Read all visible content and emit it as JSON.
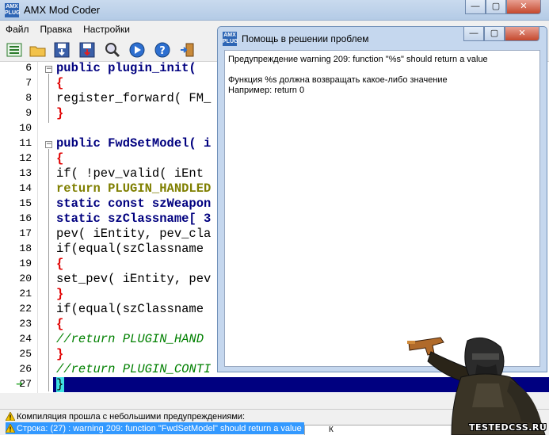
{
  "window": {
    "title": "AMX Mod Coder",
    "icon_text": "AMX\nPLUGIN"
  },
  "caption_buttons": {
    "minimize": "—",
    "maximize": "▢",
    "close": "✕"
  },
  "menu": [
    {
      "label": "Файл"
    },
    {
      "label": "Правка"
    },
    {
      "label": "Настройки"
    }
  ],
  "toolbar": [
    {
      "name": "list-icon"
    },
    {
      "name": "open-folder-icon"
    },
    {
      "name": "save-icon"
    },
    {
      "name": "save-as-icon"
    },
    {
      "name": "find-icon"
    },
    {
      "name": "compile-play-icon"
    },
    {
      "name": "help-icon"
    },
    {
      "name": "exit-icon"
    }
  ],
  "editor": {
    "lines": [
      {
        "num": "6",
        "text": "public plugin_init("
      },
      {
        "num": "7",
        "text": "{"
      },
      {
        "num": "8",
        "text": "register_forward( FM_"
      },
      {
        "num": "9",
        "text": "}"
      },
      {
        "num": "10",
        "text": ""
      },
      {
        "num": "11",
        "text": "public FwdSetModel( i"
      },
      {
        "num": "12",
        "text": "{"
      },
      {
        "num": "13",
        "text": "if( !pev_valid( iEnt"
      },
      {
        "num": "14",
        "text": "return PLUGIN_HANDLED"
      },
      {
        "num": "15",
        "text": "static const szWeapon"
      },
      {
        "num": "16",
        "text": "static szClassname[ 3"
      },
      {
        "num": "17",
        "text": "pev( iEntity, pev_cla"
      },
      {
        "num": "18",
        "text": "if(equal(szClassname"
      },
      {
        "num": "19",
        "text": "{"
      },
      {
        "num": "20",
        "text": "set_pev( iEntity, pev"
      },
      {
        "num": "21",
        "text": "}"
      },
      {
        "num": "22",
        "text": "if(equal(szClassname"
      },
      {
        "num": "23",
        "text": "{"
      },
      {
        "num": "24",
        "text": "//return PLUGIN_HAND"
      },
      {
        "num": "25",
        "text": "}"
      },
      {
        "num": "26",
        "text": "//return PLUGIN_CONTI"
      },
      {
        "num": "27",
        "text": "}"
      }
    ]
  },
  "status": {
    "line1": "Компиляция прошла с небольшими предупреждениями:",
    "line2": "Строка: (27) : warning 209: function \"FwdSetModel\" should return a value",
    "line3": "К"
  },
  "dialog": {
    "title": "Помощь в решении проблем",
    "warning": "Предупреждение warning 209: function \"%s\" should return a value",
    "desc": "Функция %s должна возвращать какое-либо значение",
    "example": "Например: return 0"
  },
  "watermark": "TESTEDCSS.RU",
  "colors": {
    "keyword": "#00007f",
    "brace": "#e00000",
    "comment": "#008000",
    "constant": "#7f7f00",
    "selection": "#000080"
  }
}
